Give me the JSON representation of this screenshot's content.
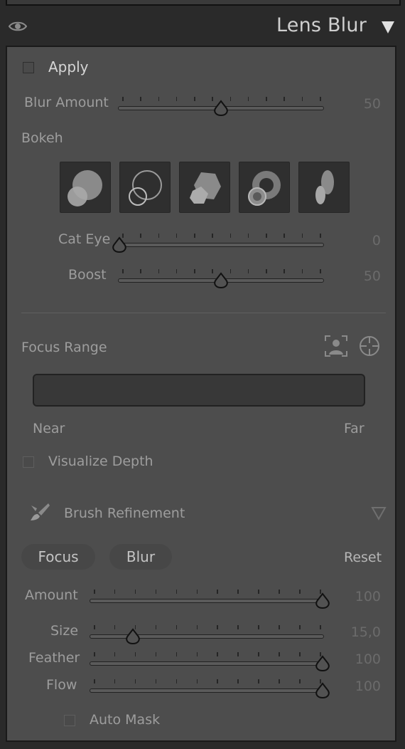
{
  "header": {
    "title": "Lens Blur",
    "eye_icon": "eye-icon",
    "collapse_icon": "triangle-down-icon"
  },
  "apply": {
    "label": "Apply",
    "checked": false
  },
  "blur_amount": {
    "label": "Blur Amount",
    "value": "50",
    "level": 0.5
  },
  "bokeh": {
    "label": "Bokeh",
    "shapes": [
      "bokeh-circle-icon",
      "bokeh-ring-icon",
      "bokeh-blade-icon",
      "bokeh-donut-icon",
      "bokeh-ellipse-icon"
    ],
    "cat_eye": {
      "label": "Cat Eye",
      "value": "0",
      "level": 0
    },
    "boost": {
      "label": "Boost",
      "value": "50",
      "level": 0.5
    }
  },
  "focus_range": {
    "label": "Focus Range",
    "subject_icon": "subject-focus-icon",
    "target_icon": "point-focus-icon",
    "near_label": "Near",
    "far_label": "Far"
  },
  "visualize_depth": {
    "label": "Visualize Depth",
    "checked": false
  },
  "brush": {
    "label": "Brush Refinement",
    "brush_icon": "brush-icon",
    "expand_icon": "triangle-down-outline-icon",
    "focus_label": "Focus",
    "blur_label": "Blur",
    "reset_label": "Reset",
    "amount": {
      "label": "Amount",
      "value": "100",
      "level": 1.0
    },
    "size": {
      "label": "Size",
      "value": "15,0",
      "level": 0.18
    },
    "feather": {
      "label": "Feather",
      "value": "100",
      "level": 1.0
    },
    "flow": {
      "label": "Flow",
      "value": "100",
      "level": 1.0
    },
    "auto_mask": {
      "label": "Auto Mask",
      "checked": false
    }
  }
}
